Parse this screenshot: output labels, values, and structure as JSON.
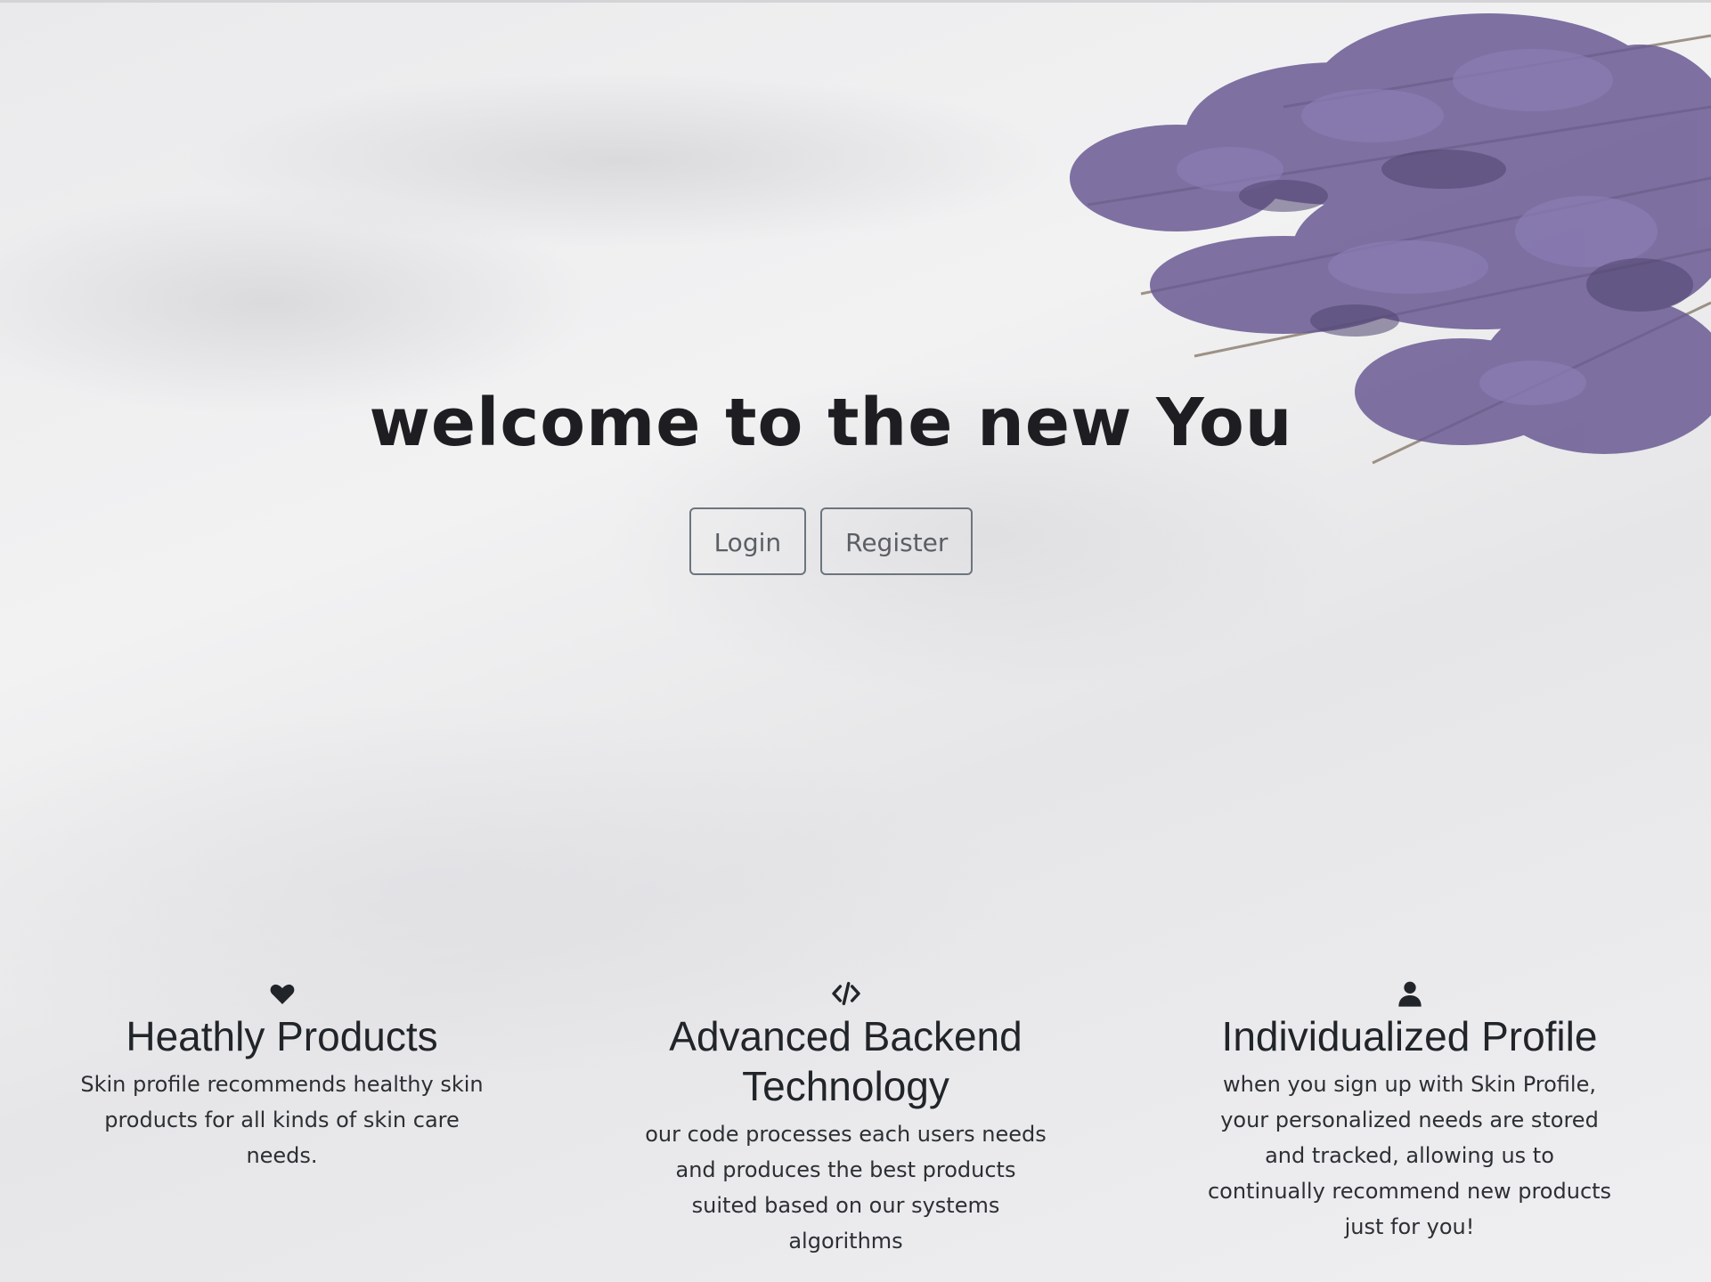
{
  "hero": {
    "title": "welcome to the new You",
    "login_label": "Login",
    "register_label": "Register"
  },
  "features": [
    {
      "icon": "heart-icon",
      "title": "Heathly Products",
      "text": "Skin profile recommends healthy skin products for all kinds of skin care needs."
    },
    {
      "icon": "code-icon",
      "title": "Advanced Backend Technology",
      "text": "our code processes each users needs and produces the best products suited based on our systems algorithms"
    },
    {
      "icon": "user-icon",
      "title": "Individualized Profile",
      "text": "when you sign up with Skin Profile, your personalized needs are stored and tracked, allowing us to continually recommend new products just for you!"
    }
  ],
  "colors": {
    "text": "#212529",
    "button_border": "#6c757d",
    "lavender": "#6a5a93"
  }
}
